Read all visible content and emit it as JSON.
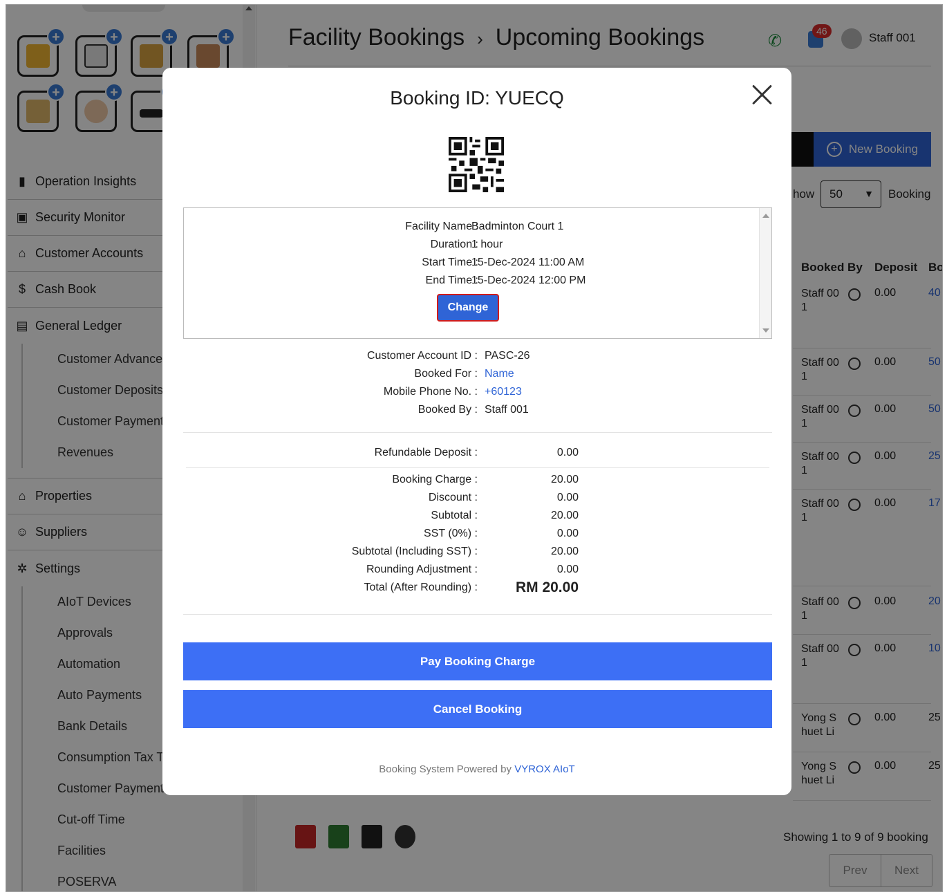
{
  "header": {
    "title": "Facility Bookings",
    "separator": "›",
    "subtitle": "Upcoming Bookings",
    "notification_count": "46",
    "user_name": "Staff 001"
  },
  "sidebar": {
    "app_icons": [
      "id-card-icon",
      "calendar-icon",
      "bank-icon",
      "building-icon",
      "keycard-icon",
      "user-avatar-icon",
      "license-plate-icon"
    ],
    "menu": [
      {
        "label": "Operation Insights",
        "icon": "bar-chart-icon"
      },
      {
        "label": "Security Monitor",
        "icon": "monitor-icon"
      },
      {
        "label": "Customer Accounts",
        "icon": "house-icon"
      },
      {
        "label": "Cash Book",
        "icon": "dollar-icon"
      },
      {
        "label": "General Ledger",
        "icon": "ledger-icon"
      }
    ],
    "ledger_sub": [
      "Customer Advances",
      "Customer Deposits",
      "Customer Payments",
      "Revenues"
    ],
    "menu2": [
      {
        "label": "Properties",
        "icon": "home-icon"
      },
      {
        "label": "Suppliers",
        "icon": "person-icon"
      },
      {
        "label": "Settings",
        "icon": "gear-icon"
      }
    ],
    "settings_sub": [
      "AIoT Devices",
      "Approvals",
      "Automation",
      "Auto Payments",
      "Bank Details",
      "Consumption Tax Typ",
      "Customer Payment V",
      "Cut-off Time",
      "Facilities",
      "POSERVA"
    ]
  },
  "main": {
    "new_booking_label": "New Booking",
    "show_label": "how",
    "show_value": "50",
    "bookings_label": "Booking",
    "columns": [
      "Booked By",
      "Deposit",
      "Bo"
    ],
    "rows": [
      {
        "by": "Staff 00 1",
        "deposit": "0.00",
        "bk": "40"
      },
      {
        "by": "Staff 00 1",
        "deposit": "0.00",
        "bk": "50"
      },
      {
        "by": "Staff 00 1",
        "deposit": "0.00",
        "bk": "50"
      },
      {
        "by": "Staff 00 1",
        "deposit": "0.00",
        "bk": "25"
      },
      {
        "by": "Staff 00 1",
        "deposit": "0.00",
        "bk": "17"
      },
      {
        "by": "Staff 00 1",
        "deposit": "0.00",
        "bk": "20"
      },
      {
        "by": "Staff 00 1",
        "deposit": "0.00",
        "bk": "10"
      },
      {
        "by": "Yong S huet Li",
        "deposit": "0.00",
        "bk": "25"
      },
      {
        "by": "Yong S huet Li",
        "deposit": "0.00",
        "bk": "25"
      }
    ],
    "showing": "Showing 1 to 9 of 9 booking",
    "prev": "Prev",
    "next": "Next",
    "export_icons": [
      "pdf-icon",
      "xls-icon",
      "printer-icon",
      "settings-cog-icon"
    ]
  },
  "modal": {
    "title": "Booking ID: YUECQ",
    "facility": {
      "name_label": "Facility Name :",
      "name_value": "Badminton Court 1",
      "duration_label": "Duration :",
      "duration_value": "1 hour",
      "start_label": "Start Time :",
      "start_value": "15-Dec-2024 11:00 AM",
      "end_label": "End Time :",
      "end_value": "15-Dec-2024 12:00 PM",
      "change_label": "Change"
    },
    "customer": {
      "account_label": "Customer Account ID :",
      "account_value": "PASC-26",
      "for_label": "Booked For :",
      "for_value": "Name",
      "phone_label": "Mobile Phone No. :",
      "phone_value": "+60123",
      "by_label": "Booked By :",
      "by_value": "Staff 001"
    },
    "charges": {
      "deposit_label": "Refundable Deposit :",
      "deposit_value": "0.00",
      "booking_label": "Booking Charge :",
      "booking_value": "20.00",
      "discount_label": "Discount :",
      "discount_value": "0.00",
      "subtotal_label": "Subtotal :",
      "subtotal_value": "20.00",
      "sst_label": "SST (0%) :",
      "sst_value": "0.00",
      "subtotal_sst_label": "Subtotal (Including SST) :",
      "subtotal_sst_value": "20.00",
      "rounding_label": "Rounding Adjustment :",
      "rounding_value": "0.00",
      "total_label": "Total (After Rounding) :",
      "total_value": "RM 20.00"
    },
    "pay_label": "Pay Booking Charge",
    "cancel_label": "Cancel Booking",
    "powered_prefix": "Booking System Powered by",
    "powered_brand": "VYROX AIoT"
  }
}
